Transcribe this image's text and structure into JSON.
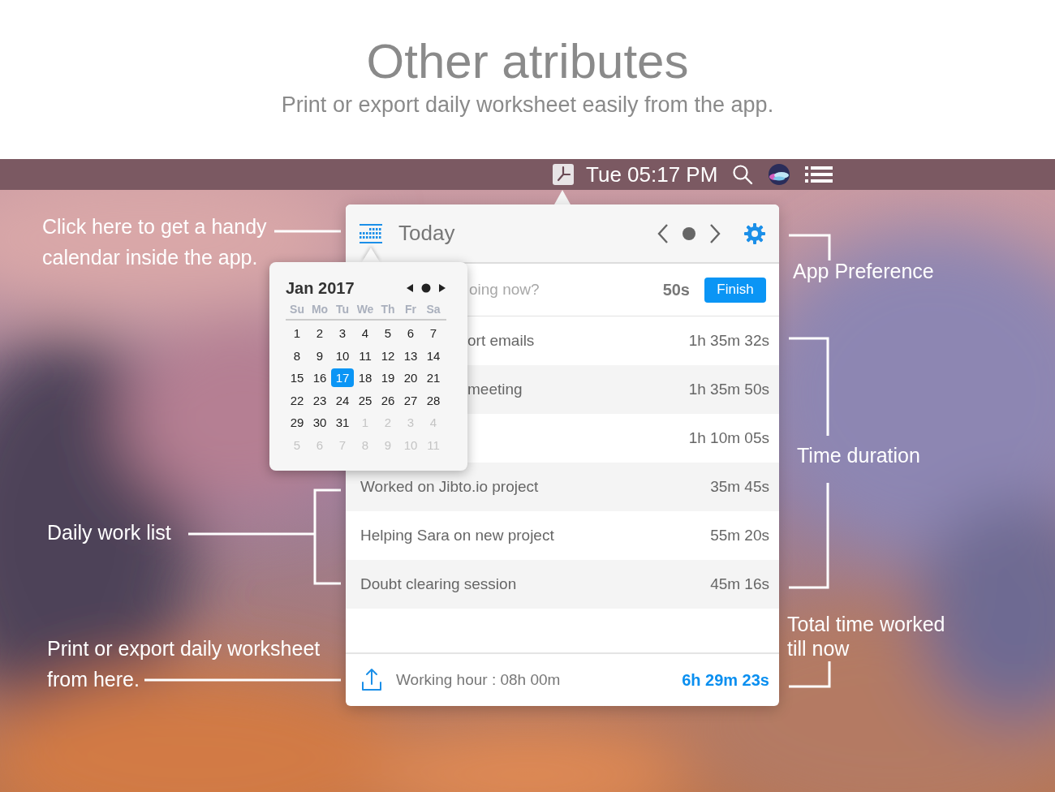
{
  "header": {
    "title": "Other atributes",
    "subtitle": "Print or export daily worksheet easily from the app."
  },
  "menu_bar": {
    "clock": "Tue 05:17 PM"
  },
  "popover": {
    "title": "Today",
    "current": {
      "placeholder": "oing now?",
      "duration": "50s",
      "button": "Finish"
    },
    "rows": [
      {
        "title": "ort emails",
        "duration": "1h 35m 32s",
        "partly_hidden": true
      },
      {
        "title": "meeting",
        "duration": "1h 35m 50s",
        "partly_hidden": true
      },
      {
        "duration": "1h 10m 05s"
      },
      {
        "title": "Worked on Jibto.io project",
        "duration": "35m 45s",
        "partly_hidden": false
      },
      {
        "title": "Helping Sara on new project",
        "duration": "55m 20s",
        "partly_hidden": false
      },
      {
        "title": "Doubt clearing session",
        "duration": "45m 16s",
        "partly_hidden": false
      }
    ],
    "footer": {
      "working_hour": "Working hour : 08h 00m",
      "total": "6h 29m 23s"
    }
  },
  "calendar": {
    "month": "Jan 2017",
    "weekdays": [
      "Su",
      "Mo",
      "Tu",
      "We",
      "Th",
      "Fr",
      "Sa"
    ],
    "weeks": [
      [
        {
          "day": "1",
          "muted": false,
          "selected": false
        },
        {
          "day": "2",
          "muted": false,
          "selected": false
        },
        {
          "day": "3",
          "muted": false,
          "selected": false
        },
        {
          "day": "4",
          "muted": false,
          "selected": false
        },
        {
          "day": "5",
          "muted": false,
          "selected": false
        },
        {
          "day": "6",
          "muted": false,
          "selected": false
        },
        {
          "day": "7",
          "muted": false,
          "selected": false
        }
      ],
      [
        {
          "day": "8",
          "muted": false,
          "selected": false
        },
        {
          "day": "9",
          "muted": false,
          "selected": false
        },
        {
          "day": "10",
          "muted": false,
          "selected": false
        },
        {
          "day": "11",
          "muted": false,
          "selected": false
        },
        {
          "day": "12",
          "muted": false,
          "selected": false
        },
        {
          "day": "13",
          "muted": false,
          "selected": false
        },
        {
          "day": "14",
          "muted": false,
          "selected": false
        }
      ],
      [
        {
          "day": "15",
          "muted": false,
          "selected": false
        },
        {
          "day": "16",
          "muted": false,
          "selected": false
        },
        {
          "day": "17",
          "muted": false,
          "selected": true
        },
        {
          "day": "18",
          "muted": false,
          "selected": false
        },
        {
          "day": "19",
          "muted": false,
          "selected": false
        },
        {
          "day": "20",
          "muted": false,
          "selected": false
        },
        {
          "day": "21",
          "muted": false,
          "selected": false
        }
      ],
      [
        {
          "day": "22",
          "muted": false,
          "selected": false
        },
        {
          "day": "23",
          "muted": false,
          "selected": false
        },
        {
          "day": "24",
          "muted": false,
          "selected": false
        },
        {
          "day": "25",
          "muted": false,
          "selected": false
        },
        {
          "day": "26",
          "muted": false,
          "selected": false
        },
        {
          "day": "27",
          "muted": false,
          "selected": false
        },
        {
          "day": "28",
          "muted": false,
          "selected": false
        }
      ],
      [
        {
          "day": "29",
          "muted": false,
          "selected": false
        },
        {
          "day": "30",
          "muted": false,
          "selected": false
        },
        {
          "day": "31",
          "muted": false,
          "selected": false
        },
        {
          "day": "1",
          "muted": true,
          "selected": false
        },
        {
          "day": "2",
          "muted": true,
          "selected": false
        },
        {
          "day": "3",
          "muted": true,
          "selected": false
        },
        {
          "day": "4",
          "muted": true,
          "selected": false
        }
      ],
      [
        {
          "day": "5",
          "muted": true,
          "selected": false
        },
        {
          "day": "6",
          "muted": true,
          "selected": false
        },
        {
          "day": "7",
          "muted": true,
          "selected": false
        },
        {
          "day": "8",
          "muted": true,
          "selected": false
        },
        {
          "day": "9",
          "muted": true,
          "selected": false
        },
        {
          "day": "10",
          "muted": true,
          "selected": false
        },
        {
          "day": "11",
          "muted": true,
          "selected": false
        }
      ]
    ]
  },
  "annotations": {
    "calendar": [
      "Click here to get a handy",
      "calendar inside the app."
    ],
    "preference": "App Preference",
    "duration": "Time duration",
    "work_list": "Daily work list",
    "export": [
      "Print or export daily worksheet",
      "from here."
    ],
    "total": [
      "Total time worked",
      "till now"
    ]
  }
}
